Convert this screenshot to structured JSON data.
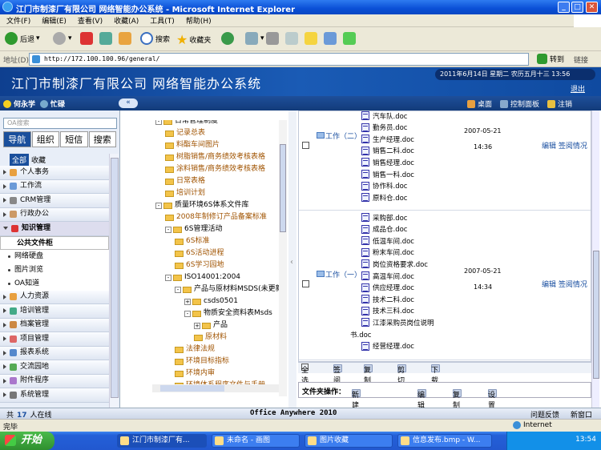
{
  "window": {
    "title": "江门市制漆厂有限公司 网络智能办公系统 - Microsoft Internet Explorer",
    "min": "_",
    "max": "□",
    "close": "✕"
  },
  "menu": [
    "文件(F)",
    "编辑(E)",
    "查看(V)",
    "收藏(A)",
    "工具(T)",
    "帮助(H)"
  ],
  "toolbar": {
    "back": "后退",
    "search": "搜索",
    "favorites": "收藏夹"
  },
  "address": {
    "label": "地址(D)",
    "url": "http://172.100.100.96/general/",
    "go": "转到",
    "links": "链接"
  },
  "banner": {
    "title": "江门市制漆厂有限公司 网络智能办公系统",
    "date": "2011年6月14日 星期二 农历五月十三 13:56",
    "exit": "退出"
  },
  "userbar": {
    "user": "何永学",
    "status": "忙碌",
    "collapse": "«",
    "desktop": "桌面",
    "control": "控制面板",
    "logout": "注销"
  },
  "left": {
    "search_placeholder": "OA搜索",
    "tabs": [
      "导航",
      "组织",
      "短信",
      "搜索"
    ],
    "subtabs": [
      "全部",
      "收藏"
    ],
    "menu": [
      "个人事务",
      "工作流",
      "CRM管理",
      "行政办公",
      "知识管理"
    ],
    "sub_items": [
      "公共文件柜",
      "网络硬盘",
      "图片浏览",
      "OA知道"
    ],
    "menu2": [
      "人力资源",
      "培训管理",
      "档案管理",
      "项目管理",
      "报表系统",
      "交流园地",
      "附件程序",
      "系统管理"
    ]
  },
  "tree": [
    {
      "label": "日常管理制度",
      "level": 1,
      "type": "folder"
    },
    {
      "label": "记录总表",
      "level": 2,
      "type": "link"
    },
    {
      "label": "料酯车间图片",
      "level": 2,
      "type": "link"
    },
    {
      "label": "树脂销售/商务绩效考核表格",
      "level": 2,
      "type": "link"
    },
    {
      "label": "涂料销售/商务绩效考核表格",
      "level": 2,
      "type": "link"
    },
    {
      "label": "日常表格",
      "level": 2,
      "type": "link"
    },
    {
      "label": "培训计划",
      "level": 2,
      "type": "link"
    },
    {
      "label": "质量环境6S体系文件库",
      "level": 1,
      "type": "folder"
    },
    {
      "label": "2008年制修订产品备案标准",
      "level": 2,
      "type": "link"
    },
    {
      "label": "6S管理活动",
      "level": 2,
      "type": "folder"
    },
    {
      "label": "6S标准",
      "level": 3,
      "type": "link"
    },
    {
      "label": "6S活动进程",
      "level": 3,
      "type": "link"
    },
    {
      "label": "6S学习园地",
      "level": 3,
      "type": "link"
    },
    {
      "label": "ISO14001:2004",
      "level": 2,
      "type": "folder"
    },
    {
      "label": "产品与原材料MSDS(未更新",
      "level": 3,
      "type": "folder"
    },
    {
      "label": "csds0501",
      "level": 4,
      "type": "plus"
    },
    {
      "label": "物质安全资料表Msds",
      "level": 4,
      "type": "folder"
    },
    {
      "label": "产品",
      "level": 5,
      "type": "plus"
    },
    {
      "label": "原材料",
      "level": 5,
      "type": "link"
    },
    {
      "label": "法律法规",
      "level": 3,
      "type": "link"
    },
    {
      "label": "环境目标指标",
      "level": 3,
      "type": "link"
    },
    {
      "label": "环境内审",
      "level": 3,
      "type": "link"
    },
    {
      "label": "环境体系程序文件与手册",
      "level": 3,
      "type": "link"
    }
  ],
  "rows": [
    {
      "name": "工作（二）",
      "date": "2007-05-21",
      "time": "14:36",
      "ops": "编辑 签阅情况",
      "files": [
        "汽车队.doc",
        "勤务员.doc",
        "生产经理.doc",
        "销售二科.doc",
        "销售经理.doc",
        "销售一科.doc",
        "协作科.doc",
        "原料仓.doc"
      ]
    },
    {
      "name": "工作（一）",
      "date": "2007-05-21",
      "time": "14:34",
      "ops": "编辑 签阅情况",
      "files": [
        "采购部.doc",
        "成品仓.doc",
        "低温车间.doc",
        "粉末车间.doc",
        "岗位资格要求.doc",
        "高温车间.doc",
        "供应经理.doc",
        "技术二科.doc",
        "技术三科.doc",
        "江漆采购员岗位说明",
        "书.doc",
        "经营经理.doc"
      ]
    }
  ],
  "ops1": [
    "全选",
    "签阅",
    "复制",
    "剪切",
    "下载"
  ],
  "ops2": {
    "label": "文件夹操作：",
    "items": [
      "新建子文件夹",
      "编辑",
      "复制",
      "设置权限"
    ]
  },
  "footer": {
    "prefix": "共",
    "count": "17",
    "suffix": "人在线",
    "center": "Office Anywhere 2010",
    "feedback": "问题反馈",
    "new_window": "新窗口"
  },
  "status": {
    "left": "完毕",
    "zone": "Internet"
  },
  "taskbar": {
    "start": "开始",
    "items": [
      "江门市制漆厂有...",
      "未命名 - 画图",
      "图片收藏",
      "信息发布.bmp - W..."
    ],
    "clock": "13:54"
  },
  "colors": {
    "accent": "#1a4f9c",
    "banner": "#0e3f8f",
    "link": "#1a4fa0"
  }
}
